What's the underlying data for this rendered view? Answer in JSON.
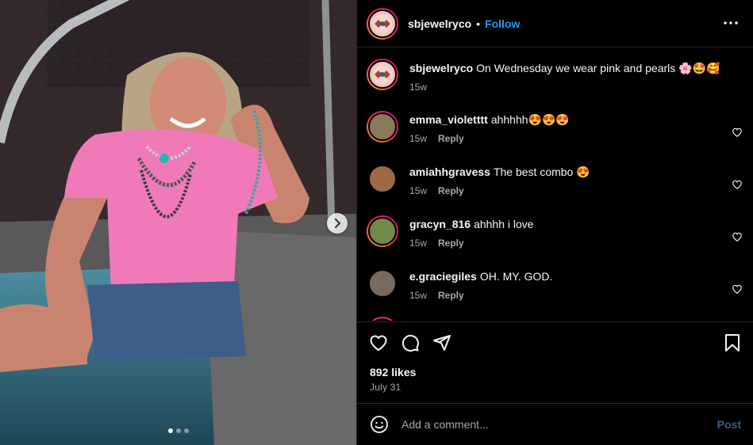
{
  "post": {
    "author": "sbjewelryco",
    "separator": "•",
    "follow_label": "Follow",
    "carousel": {
      "slides": 3,
      "active": 1
    }
  },
  "comments": [
    {
      "username": "sbjewelryco",
      "text": "On Wednesday we wear pink and pearls 🌸🤩🥰",
      "time": "15w",
      "reply": "",
      "liked": false,
      "ring": true
    },
    {
      "username": "emma_violetttt",
      "text": "ahhhhh😍😍😍",
      "time": "15w",
      "reply": "Reply",
      "ring": true
    },
    {
      "username": "amiahhgravess",
      "text": "The best combo 😍",
      "time": "15w",
      "reply": "Reply",
      "ring": false
    },
    {
      "username": "gracyn_816",
      "text": "ahhhh i love",
      "time": "15w",
      "reply": "Reply",
      "ring": true
    },
    {
      "username": "e.graciegiles",
      "text": "OH. MY. GOD.",
      "time": "15w",
      "reply": "Reply",
      "ring": false
    }
  ],
  "stats": {
    "likes": "892 likes",
    "date": "July 31"
  },
  "composer": {
    "placeholder": "Add a comment...",
    "post_label": "Post"
  },
  "icons": [
    "more-icon",
    "heart-icon",
    "comment-icon",
    "share-icon",
    "bookmark-icon",
    "emoji-icon",
    "chevron-right-icon"
  ],
  "colors": {
    "background": "#000000",
    "link": "#1d9bf0",
    "muted": "#a8a8a8",
    "divider": "#262626",
    "post_disabled": "#3b5f8a"
  }
}
